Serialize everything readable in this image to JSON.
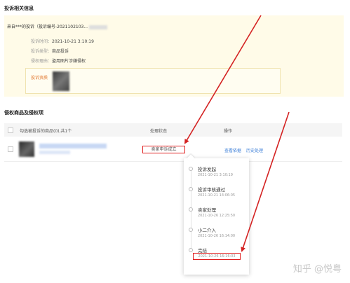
{
  "complaint_section": {
    "title": "投诉相关信息",
    "header_text": "来自***的投诉（投诉编号-2021102103...",
    "rows": [
      {
        "label": "投诉时间：",
        "value": "2021-10-21 3:10:19"
      },
      {
        "label": "投诉类型：",
        "value": "商品投诉"
      },
      {
        "label": "侵权理由：",
        "value": "盗用图片涉嫌侵权"
      }
    ],
    "evidence_label": "投诉资质"
  },
  "products_section": {
    "title": "侵权商品及侵权项",
    "table_header": {
      "select_all_text": "勾选被投诉的商品(0),共1个",
      "status_col": "处理状态",
      "action_col": "操作"
    },
    "row": {
      "status": "卖家申诉成立",
      "action_view_evidence": "查看依据",
      "action_history": "历史处理"
    }
  },
  "timeline": [
    {
      "title": "投诉发起",
      "date": "2021-10-21 3:10:19"
    },
    {
      "title": "投诉审核通过",
      "date": "2021-10-21 14:06:05"
    },
    {
      "title": "卖家处理",
      "date": "2021-10-26 12:25:50"
    },
    {
      "title": "小二介入",
      "date": "2021-10-26 16:14:00"
    },
    {
      "title": "完结",
      "date": "2021-10-26 16:16:03"
    }
  ],
  "watermark": "知乎 @悦粤",
  "colors": {
    "highlight_box": "#e02020",
    "arrow": "#d42222",
    "link": "#3d7fd8",
    "info_panel_bg": "#fffbe8",
    "evidence_label": "#e2762d"
  }
}
